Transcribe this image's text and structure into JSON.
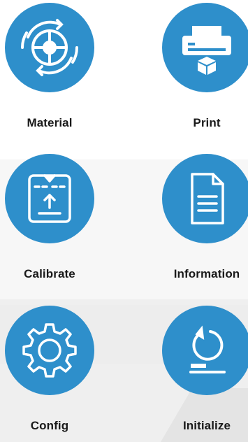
{
  "menu": {
    "items": [
      {
        "label": "Material",
        "icon": "material-target-icon"
      },
      {
        "label": "Print",
        "icon": "printer-icon"
      },
      {
        "label": "Calibrate",
        "icon": "calibrate-icon"
      },
      {
        "label": "Information",
        "icon": "document-icon"
      },
      {
        "label": "Config",
        "icon": "gear-icon"
      },
      {
        "label": "Initialize",
        "icon": "reset-icon"
      }
    ]
  },
  "colors": {
    "accent": "#2e8fcb",
    "label": "#1a1a1a"
  }
}
